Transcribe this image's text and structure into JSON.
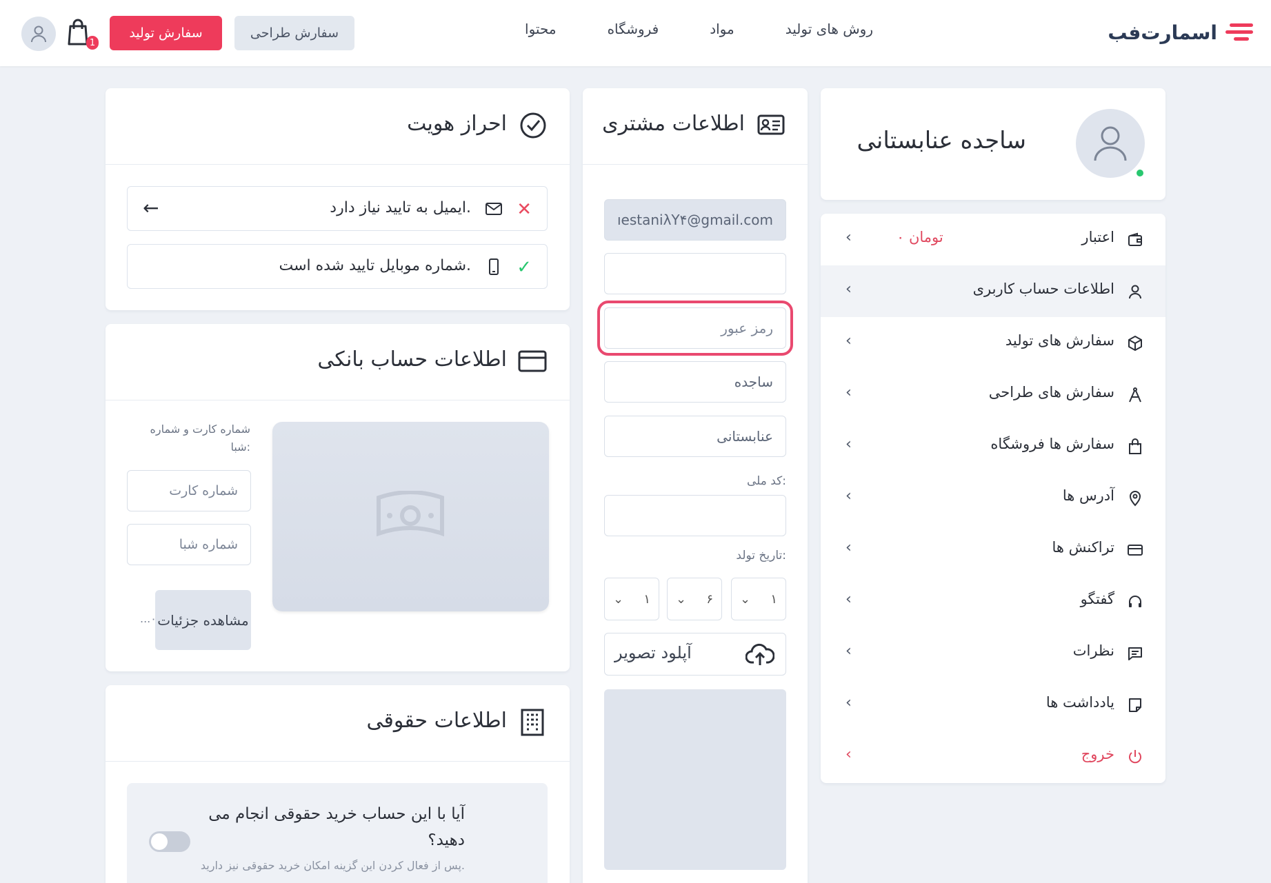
{
  "header": {
    "logo_text": "اسمارت‌فب",
    "nav": [
      "روش های تولید",
      "مواد",
      "فروشگاه",
      "محتوا"
    ],
    "design_order_label": "سفارش طراحی",
    "production_order_label": "سفارش تولید",
    "cart_count": "1"
  },
  "profile": {
    "name": "ساجده عنابستانی"
  },
  "menu": {
    "items": [
      {
        "label": "اعتبار",
        "extra": "۰ تومان",
        "icon": "wallet-icon"
      },
      {
        "label": "اطلاعات حساب کاربری",
        "icon": "user-icon"
      },
      {
        "label": "سفارش های تولید",
        "icon": "box-icon"
      },
      {
        "label": "سفارش های طراحی",
        "icon": "compass-icon"
      },
      {
        "label": "سفارش ها فروشگاه",
        "icon": "shopping-bag-icon"
      },
      {
        "label": "آدرس ها",
        "icon": "map-pin-icon"
      },
      {
        "label": "تراکنش ها",
        "icon": "credit-card-icon"
      },
      {
        "label": "گفتگو",
        "icon": "headphones-icon"
      },
      {
        "label": "نظرات",
        "icon": "comment-icon"
      },
      {
        "label": "یادداشت ها",
        "icon": "note-icon"
      },
      {
        "label": "خروج",
        "icon": "power-icon"
      }
    ]
  },
  "customer": {
    "title": "اطلاعات مشتری",
    "email": "ıestaniλY۴@gmail.com",
    "phone": "",
    "password_placeholder": "رمز عبور",
    "first_name": "ساجده",
    "last_name": "عنابستانی",
    "national_code_label": "کد ملی:",
    "national_code": "",
    "birth_label": "تاریخ تولد:",
    "birth": {
      "day": "۱",
      "month": "۶",
      "year": "۱"
    },
    "upload_label": "آپلود تصویر"
  },
  "identity": {
    "title": "احراز هویت",
    "email_status": "ایمیل به تایید نیاز دارد.",
    "mobile_status": "شماره موبایل تایید شده است.",
    "colors": {
      "error": "#e94a5f",
      "success": "#28c76f"
    }
  },
  "bank": {
    "title": "اطلاعات حساب بانکی",
    "hint": "شماره کارت و شماره شبا:",
    "card_placeholder": "شماره کارت",
    "sheba_placeholder": "شماره شبا",
    "details_label": "مشاهده جزئیات",
    "ellipsis": "...۰"
  },
  "legal": {
    "title": "اطلاعات حقوقی",
    "question": "آیا با این حساب خرید حقوقی انجام می دهید؟",
    "hint": "پس از فعال کردن این گزینه امکان خرید حقوقی نیز دارید."
  }
}
